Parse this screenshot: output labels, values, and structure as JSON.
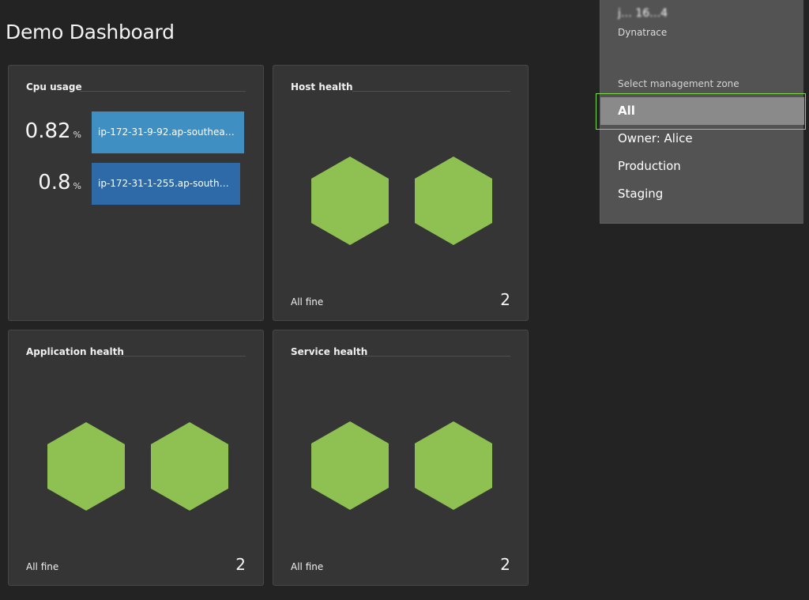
{
  "dashboard": {
    "title": "Demo Dashboard"
  },
  "tiles": {
    "cpu": {
      "title": "Cpu usage",
      "rows": [
        {
          "value": "0.82",
          "unit": "%",
          "host": "ip-172-31-9-92.ap-southeast-...",
          "color": "#3f8fc2",
          "share": 1.0
        },
        {
          "value": "0.8",
          "unit": "%",
          "host": "ip-172-31-1-255.ap-southeast...",
          "color": "#2f6aa8",
          "share": 0.976
        }
      ]
    },
    "host_health": {
      "title": "Host health",
      "footer": "All fine",
      "count": "2"
    },
    "application_health": {
      "title": "Application health",
      "footer": "All fine",
      "count": "2"
    },
    "service_health": {
      "title": "Service health",
      "footer": "All fine",
      "count": "2"
    }
  },
  "zone_menu": {
    "user": "j… 16…4",
    "org": "Dynatrace",
    "label": "Select management zone",
    "items": [
      {
        "label": "All",
        "selected": true
      },
      {
        "label": "Owner: Alice",
        "selected": false
      },
      {
        "label": "Production",
        "selected": false
      },
      {
        "label": "Staging",
        "selected": false
      }
    ]
  },
  "colors": {
    "healthy": "#8ec152",
    "focus": "#7ddc4a"
  }
}
